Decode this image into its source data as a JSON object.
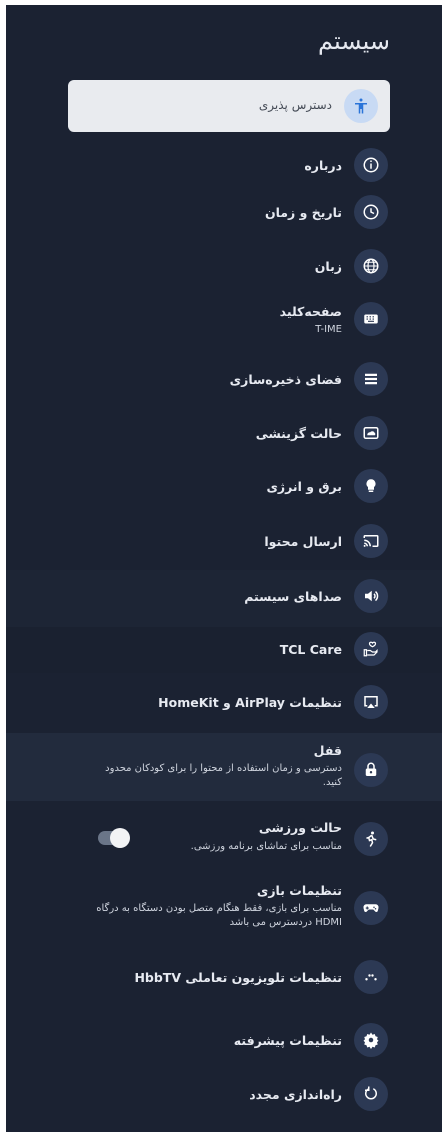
{
  "page_title": "سیستم",
  "items": [
    {
      "id": "accessibility",
      "label": "دسترس پذیری",
      "icon": "accessibility-icon"
    },
    {
      "id": "about",
      "label": "درباره",
      "icon": "info-icon"
    },
    {
      "id": "datetime",
      "label": "تاریخ و زمان",
      "icon": "clock-icon"
    },
    {
      "id": "language",
      "label": "زبان",
      "icon": "globe-icon"
    },
    {
      "id": "keyboard",
      "label": "صفحه‌کلید",
      "sub": "T-IME",
      "icon": "keyboard-icon"
    },
    {
      "id": "storage",
      "label": "فضای ذخیره‌سازی",
      "icon": "storage-icon"
    },
    {
      "id": "ambient",
      "label": "حالت گزینشی",
      "icon": "ambient-icon"
    },
    {
      "id": "power",
      "label": "برق و انرژی",
      "icon": "lightbulb-icon"
    },
    {
      "id": "cast",
      "label": "ارسال محتوا",
      "icon": "cast-icon"
    },
    {
      "id": "sounds",
      "label": "صداهای سیستم",
      "icon": "speaker-icon"
    },
    {
      "id": "tclcare",
      "label": "TCL Care",
      "icon": "care-hand-icon"
    },
    {
      "id": "airplay",
      "label": "تنظیمات AirPlay و HomeKit",
      "icon": "airplay-icon"
    },
    {
      "id": "lock",
      "label": "قفل",
      "sub": "دسترسی و زمان استفاده از محتوا را برای کودکان محدود کنید.",
      "icon": "lock-icon"
    },
    {
      "id": "sports",
      "label": "حالت ورزشی",
      "sub": "مناسب برای تماشای برنامه ورزشی.",
      "icon": "running-icon",
      "toggle": "on"
    },
    {
      "id": "game",
      "label": "تنظیمات بازی",
      "sub": "مناسب برای بازی، فقط هنگام متصل بودن دستگاه به درگاه HDMI دردسترس می باشد",
      "icon": "gamepad-icon"
    },
    {
      "id": "hbbtv",
      "label": "تنظیمات تلویزیون تعاملی HbbTV",
      "icon": "dots-icon"
    },
    {
      "id": "advanced",
      "label": "تنظیمات پیشرفته",
      "icon": "gear-icon"
    },
    {
      "id": "restart",
      "label": "راه‌اندازی مجدد",
      "icon": "restart-icon"
    }
  ]
}
